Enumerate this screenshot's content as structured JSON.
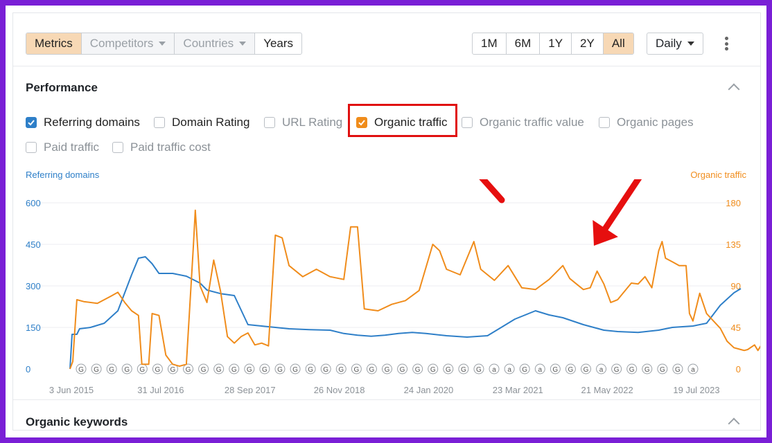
{
  "toolbar": {
    "tabs": [
      {
        "label": "Metrics",
        "state": "active"
      },
      {
        "label": "Competitors",
        "state": "disabled",
        "has_dropdown": true
      },
      {
        "label": "Countries",
        "state": "disabled",
        "has_dropdown": true
      },
      {
        "label": "Years",
        "state": "normal"
      }
    ],
    "ranges": [
      "1M",
      "6M",
      "1Y",
      "2Y",
      "All"
    ],
    "active_range": "All",
    "granularity": "Daily"
  },
  "performance": {
    "title": "Performance",
    "checkboxes": [
      {
        "label": "Referring domains",
        "checked": true,
        "color": "#2e7fc8"
      },
      {
        "label": "Domain Rating",
        "checked": false
      },
      {
        "label": "URL Rating",
        "checked": false,
        "muted": true
      },
      {
        "label": "Organic traffic",
        "checked": true,
        "color": "#f08c1b",
        "highlighted": true
      },
      {
        "label": "Organic traffic value",
        "checked": false,
        "muted": true
      },
      {
        "label": "Organic pages",
        "checked": false,
        "muted": true
      },
      {
        "label": "Paid traffic",
        "checked": false,
        "muted": true
      },
      {
        "label": "Paid traffic cost",
        "checked": false,
        "muted": true
      }
    ]
  },
  "chart_data": {
    "type": "line",
    "left_axis_label": "Referring domains",
    "right_axis_label": "Organic traffic",
    "left_ticks": [
      "0",
      "150",
      "300",
      "450",
      "600"
    ],
    "right_ticks": [
      "0",
      "45",
      "90",
      "135",
      "180"
    ],
    "left_ylim": [
      0,
      600
    ],
    "right_ylim": [
      0,
      180
    ],
    "x_tick_labels": [
      "3 Jun 2015",
      "31 Jul 2016",
      "28 Sep 2017",
      "26 Nov 2018",
      "24 Jan 2020",
      "23 Mar 2021",
      "21 May 2022",
      "19 Jul 2023"
    ],
    "x_domain_months": [
      0,
      98
    ],
    "series": [
      {
        "name": "Referring domains",
        "axis": "left",
        "color": "#2e7fc8",
        "points": [
          [
            0,
            0
          ],
          [
            0.3,
            125
          ],
          [
            1,
            125
          ],
          [
            1.4,
            145
          ],
          [
            3,
            150
          ],
          [
            5,
            165
          ],
          [
            7,
            210
          ],
          [
            9,
            340
          ],
          [
            10,
            400
          ],
          [
            11,
            405
          ],
          [
            12,
            380
          ],
          [
            13,
            345
          ],
          [
            15,
            345
          ],
          [
            17,
            335
          ],
          [
            19,
            310
          ],
          [
            20,
            285
          ],
          [
            22,
            272
          ],
          [
            24,
            265
          ],
          [
            26,
            160
          ],
          [
            28,
            155
          ],
          [
            30,
            150
          ],
          [
            32,
            145
          ],
          [
            35,
            142
          ],
          [
            38,
            140
          ],
          [
            40,
            128
          ],
          [
            42,
            122
          ],
          [
            44,
            118
          ],
          [
            46,
            122
          ],
          [
            48,
            128
          ],
          [
            50,
            132
          ],
          [
            52,
            128
          ],
          [
            55,
            120
          ],
          [
            58,
            115
          ],
          [
            61,
            120
          ],
          [
            63,
            150
          ],
          [
            65,
            180
          ],
          [
            67,
            200
          ],
          [
            68,
            210
          ],
          [
            70,
            195
          ],
          [
            72,
            185
          ],
          [
            75,
            160
          ],
          [
            78,
            140
          ],
          [
            80,
            135
          ],
          [
            83,
            132
          ],
          [
            86,
            140
          ],
          [
            88,
            150
          ],
          [
            91,
            155
          ],
          [
            93,
            165
          ],
          [
            95,
            230
          ],
          [
            97,
            275
          ],
          [
            98,
            290
          ]
        ]
      },
      {
        "name": "Organic traffic",
        "axis": "right",
        "color": "#f08c1b",
        "points": [
          [
            0,
            0
          ],
          [
            0.4,
            8
          ],
          [
            1,
            75
          ],
          [
            2,
            73
          ],
          [
            4,
            71
          ],
          [
            6,
            79
          ],
          [
            7,
            83
          ],
          [
            8,
            72
          ],
          [
            9,
            63
          ],
          [
            10,
            58
          ],
          [
            10.5,
            5
          ],
          [
            11.5,
            5
          ],
          [
            12,
            60
          ],
          [
            13,
            58
          ],
          [
            14,
            15
          ],
          [
            15,
            5
          ],
          [
            16,
            3
          ],
          [
            17,
            5
          ],
          [
            18,
            130
          ],
          [
            18.3,
            172
          ],
          [
            19,
            90
          ],
          [
            20,
            72
          ],
          [
            21,
            118
          ],
          [
            22,
            84
          ],
          [
            23,
            35
          ],
          [
            24,
            28
          ],
          [
            25,
            35
          ],
          [
            26,
            39
          ],
          [
            27,
            26
          ],
          [
            28,
            28
          ],
          [
            29,
            25
          ],
          [
            30,
            145
          ],
          [
            31,
            142
          ],
          [
            32,
            112
          ],
          [
            34,
            100
          ],
          [
            36,
            108
          ],
          [
            38,
            100
          ],
          [
            40,
            97
          ],
          [
            41,
            154
          ],
          [
            42,
            154
          ],
          [
            43,
            65
          ],
          [
            45,
            63
          ],
          [
            47,
            70
          ],
          [
            49,
            74
          ],
          [
            51,
            85
          ],
          [
            53,
            135
          ],
          [
            54,
            128
          ],
          [
            55,
            108
          ],
          [
            57,
            102
          ],
          [
            59,
            138
          ],
          [
            60,
            108
          ],
          [
            62,
            96
          ],
          [
            64,
            112
          ],
          [
            66,
            88
          ],
          [
            68,
            86
          ],
          [
            70,
            97
          ],
          [
            72,
            112
          ],
          [
            73,
            98
          ],
          [
            74,
            92
          ],
          [
            75,
            86
          ],
          [
            76,
            88
          ],
          [
            77,
            106
          ],
          [
            78,
            92
          ],
          [
            79,
            72
          ],
          [
            80,
            75
          ],
          [
            81,
            84
          ],
          [
            82,
            93
          ],
          [
            83,
            92
          ],
          [
            84,
            100
          ],
          [
            85,
            88
          ],
          [
            86,
            128
          ],
          [
            86.5,
            138
          ],
          [
            87,
            120
          ],
          [
            88,
            116
          ],
          [
            89,
            112
          ],
          [
            90,
            112
          ],
          [
            90.5,
            60
          ],
          [
            91,
            52
          ],
          [
            92,
            82
          ],
          [
            93,
            60
          ],
          [
            94,
            52
          ],
          [
            95,
            44
          ],
          [
            96,
            30
          ],
          [
            97,
            23
          ],
          [
            98,
            21
          ],
          [
            98.5,
            20
          ],
          [
            99,
            21
          ],
          [
            100,
            26
          ],
          [
            100.5,
            20
          ],
          [
            101,
            26
          ],
          [
            101.5,
            90
          ],
          [
            102,
            86
          ],
          [
            103,
            88
          ]
        ]
      }
    ],
    "annotation_markers": [
      "G",
      "G",
      "G",
      "G",
      "G",
      "G",
      "G",
      "G",
      "G",
      "G",
      "G",
      "G",
      "G",
      "G",
      "G",
      "G",
      "G",
      "G",
      "G",
      "G",
      "G",
      "G",
      "G",
      "G",
      "G",
      "G",
      "G",
      "a",
      "a",
      "G",
      "a",
      "G",
      "G",
      "G",
      "a",
      "G",
      "G",
      "G",
      "G",
      "G",
      "a"
    ]
  },
  "organic_keywords": {
    "title": "Organic keywords"
  }
}
